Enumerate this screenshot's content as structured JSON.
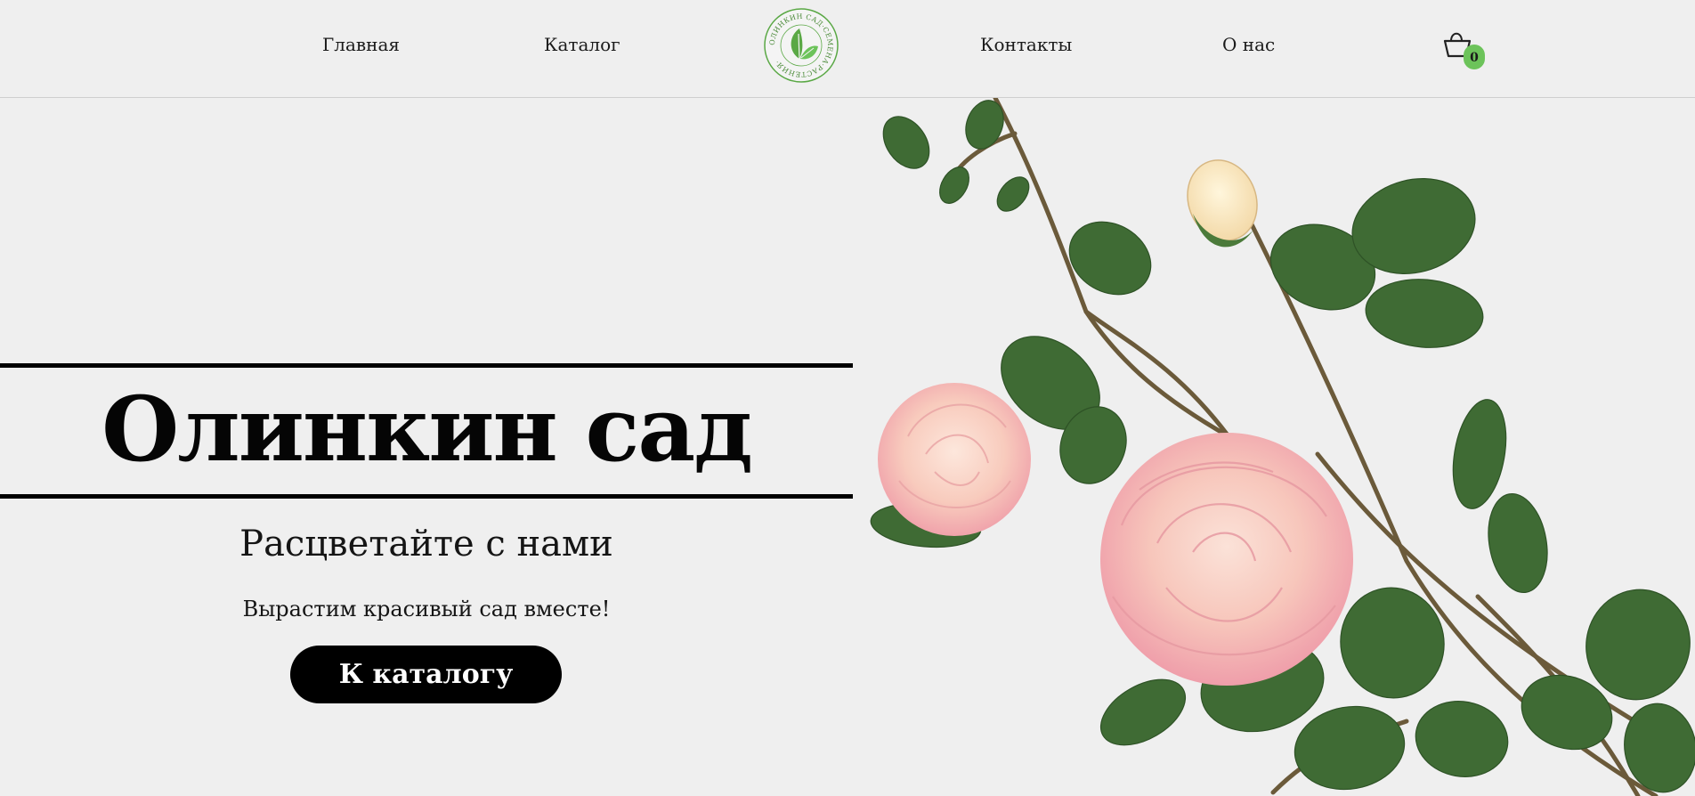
{
  "nav": {
    "home": "Главная",
    "catalog": "Каталог",
    "contacts": "Контакты",
    "about": "О нас"
  },
  "logo": {
    "ring_text": "ОЛИНКИН САД·СЕМЕНА·РАСТЕНИЯ·",
    "icon": "leaf-logo-icon",
    "color": "#5aa845"
  },
  "cart": {
    "icon": "basket-icon",
    "count": "0",
    "badge_color": "#6cc35a"
  },
  "hero": {
    "title": "Олинкин сад",
    "subtitle": "Расцветайте с нами",
    "tagline": "Вырастим красивый сад вместе!",
    "cta_label": "К каталогу",
    "image": "rose-branch-image"
  },
  "colors": {
    "background": "#efefef",
    "text": "#111111",
    "button": "#000000",
    "accent": "#6cc35a"
  }
}
